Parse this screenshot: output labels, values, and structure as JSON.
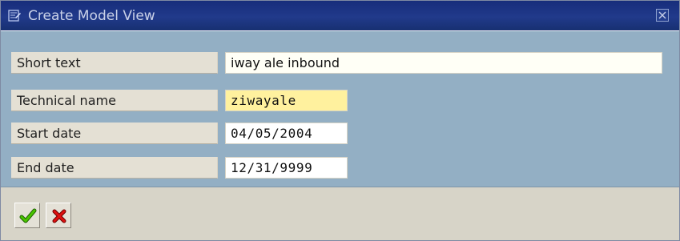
{
  "window": {
    "title": "Create Model View",
    "title_icon": "create-document-icon",
    "close_icon": "close-icon"
  },
  "form": {
    "fields": [
      {
        "label": "Short text",
        "value": "iway ale inbound"
      },
      {
        "label": "Technical name",
        "value": "ziwayale"
      },
      {
        "label": "Start date",
        "value": "04/05/2004"
      },
      {
        "label": "End date",
        "value": "12/31/9999"
      }
    ]
  },
  "actions": {
    "confirm_icon": "checkmark-icon",
    "cancel_icon": "cancel-icon"
  },
  "colors": {
    "titlebar": "#213a8b",
    "content": "#93afc4",
    "footer": "#d7d4c8",
    "required_field": "#fff19e",
    "confirm": "#39a700",
    "cancel": "#c80000"
  }
}
